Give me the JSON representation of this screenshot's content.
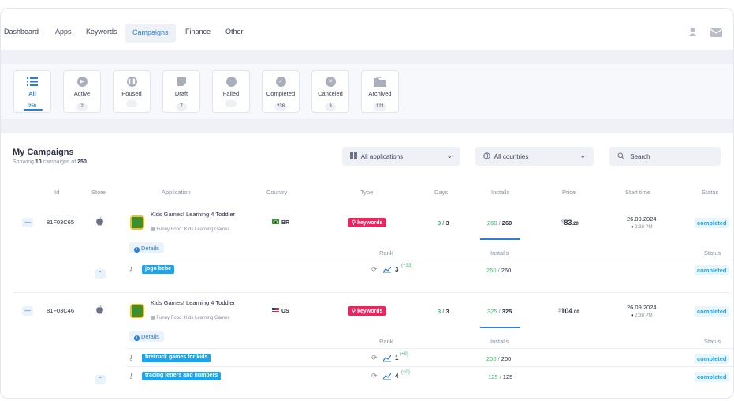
{
  "nav": {
    "items": [
      "Dashboard",
      "Apps",
      "Keywords",
      "Campaigns",
      "Finance",
      "Other"
    ]
  },
  "tabs": [
    {
      "label": "All",
      "count": "250",
      "icon": "list-icon"
    },
    {
      "label": "Active",
      "count": "2",
      "icon": "play-icon"
    },
    {
      "label": "Poused",
      "count": "",
      "icon": "pause-icon"
    },
    {
      "label": "Draft",
      "count": "7",
      "icon": "draft-icon"
    },
    {
      "label": "Failed",
      "count": "",
      "icon": "minus-icon"
    },
    {
      "label": "Completed",
      "count": "238",
      "icon": "check-icon"
    },
    {
      "label": "Canceled",
      "count": "3",
      "icon": "x-icon"
    },
    {
      "label": "Archived",
      "count": "121",
      "icon": "folder-icon"
    }
  ],
  "section": {
    "title": "My Campaigns",
    "showing_prefix": "Showing",
    "showing_count": "10",
    "showing_mid": "campaigns of",
    "showing_total": "250"
  },
  "filters": {
    "apps": "All applications",
    "countries": "All countries",
    "search_placeholder": "Search"
  },
  "columns": [
    "Id",
    "Store",
    "Application",
    "Country",
    "Type",
    "Days",
    "Installs",
    "Price",
    "Start time",
    "Status"
  ],
  "subcolumns": {
    "details": "Details",
    "rank": "Rank",
    "installs": "Installs",
    "status": "Status"
  },
  "campaigns": [
    {
      "id": "81F03C65",
      "app_name": "Kids Games! Learning 4 Toddler",
      "app_dev": "Funny Food: Kids Learning Games",
      "country": "BR",
      "type": "keywords",
      "days_done": "3",
      "days_total": "3",
      "installs_done": "260",
      "installs_total": "260",
      "installs_progress": 1.0,
      "price_symbol": "$",
      "price_int": "83",
      "price_dec": ".20",
      "date": "26.09.2024",
      "time": "2:38 PM",
      "status": "completed",
      "keywords": [
        {
          "kw": "jogo bebe",
          "rank": "3",
          "delta": "(+33)",
          "inst_done": "260",
          "inst_total": "260",
          "status": "completed"
        }
      ]
    },
    {
      "id": "81F03C46",
      "app_name": "Kids Games! Learning 4 Toddler",
      "app_dev": "Funny Food: Kids Learning Games",
      "country": "US",
      "type": "keywords",
      "days_done": "3",
      "days_total": "3",
      "installs_done": "325",
      "installs_total": "325",
      "installs_progress": 1.0,
      "price_symbol": "$",
      "price_int": "104",
      "price_dec": ".00",
      "date": "26.09.2024",
      "time": "2:38 PM",
      "status": "completed",
      "keywords": [
        {
          "kw": "firetruck games for kids",
          "rank": "1",
          "delta": "(+9)",
          "inst_done": "200",
          "inst_total": "200",
          "status": "completed"
        },
        {
          "kw": "tracing letters and numbers",
          "rank": "4",
          "delta": "(+0)",
          "inst_done": "125",
          "inst_total": "125",
          "status": "completed"
        }
      ]
    }
  ],
  "colors": {
    "accent": "#2a7fd4",
    "keyword_badge": "#e8265e",
    "keyword_tag": "#1ea4e9",
    "success": "#3dbb6c"
  }
}
